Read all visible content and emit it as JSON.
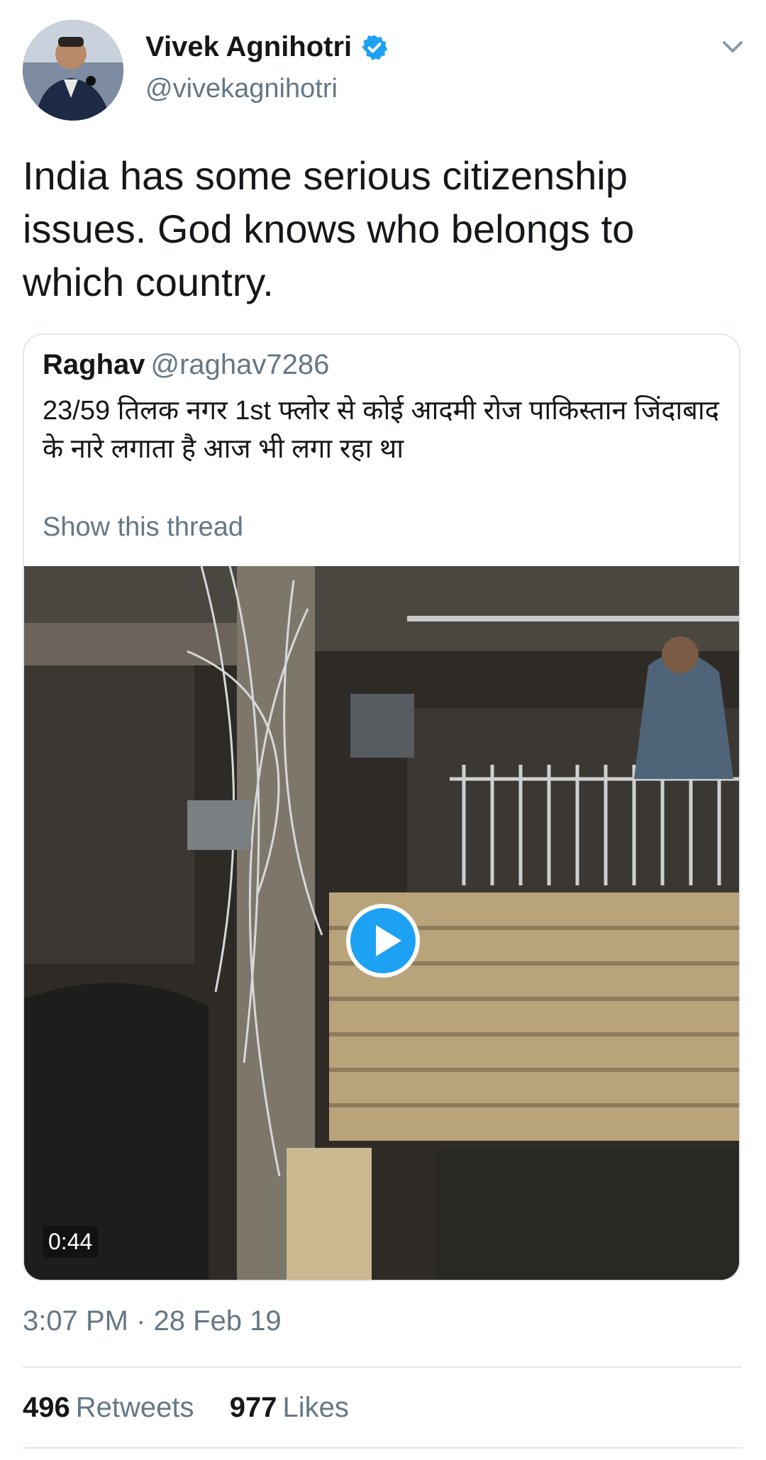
{
  "author": {
    "name": "Vivek Agnihotri",
    "handle": "@vivekagnihotri",
    "verified": true,
    "avatar_icon": "profile-photo"
  },
  "tweet": {
    "text": "India has some serious citizenship issues. God knows who belongs to which country."
  },
  "quoted_tweet": {
    "name": "Raghav",
    "handle": "@raghav7286",
    "text": "23/59 तिलक नगर  1st फ्लोर से कोई आदमी रोज पाकिस्तान जिंदाबाद के नारे लगाता है आज भी लगा रहा था",
    "thread_link": "Show this thread",
    "video": {
      "duration": "0:44",
      "play_icon": "play-icon"
    }
  },
  "timestamp": "3:07 PM · 28 Feb 19",
  "stats": {
    "retweets_count": "496",
    "retweets_label": "Retweets",
    "likes_count": "977",
    "likes_label": "Likes"
  },
  "colors": {
    "accent": "#1da1f2",
    "text_primary": "#14171a",
    "text_secondary": "#657786",
    "divider": "#e1e8ed"
  }
}
